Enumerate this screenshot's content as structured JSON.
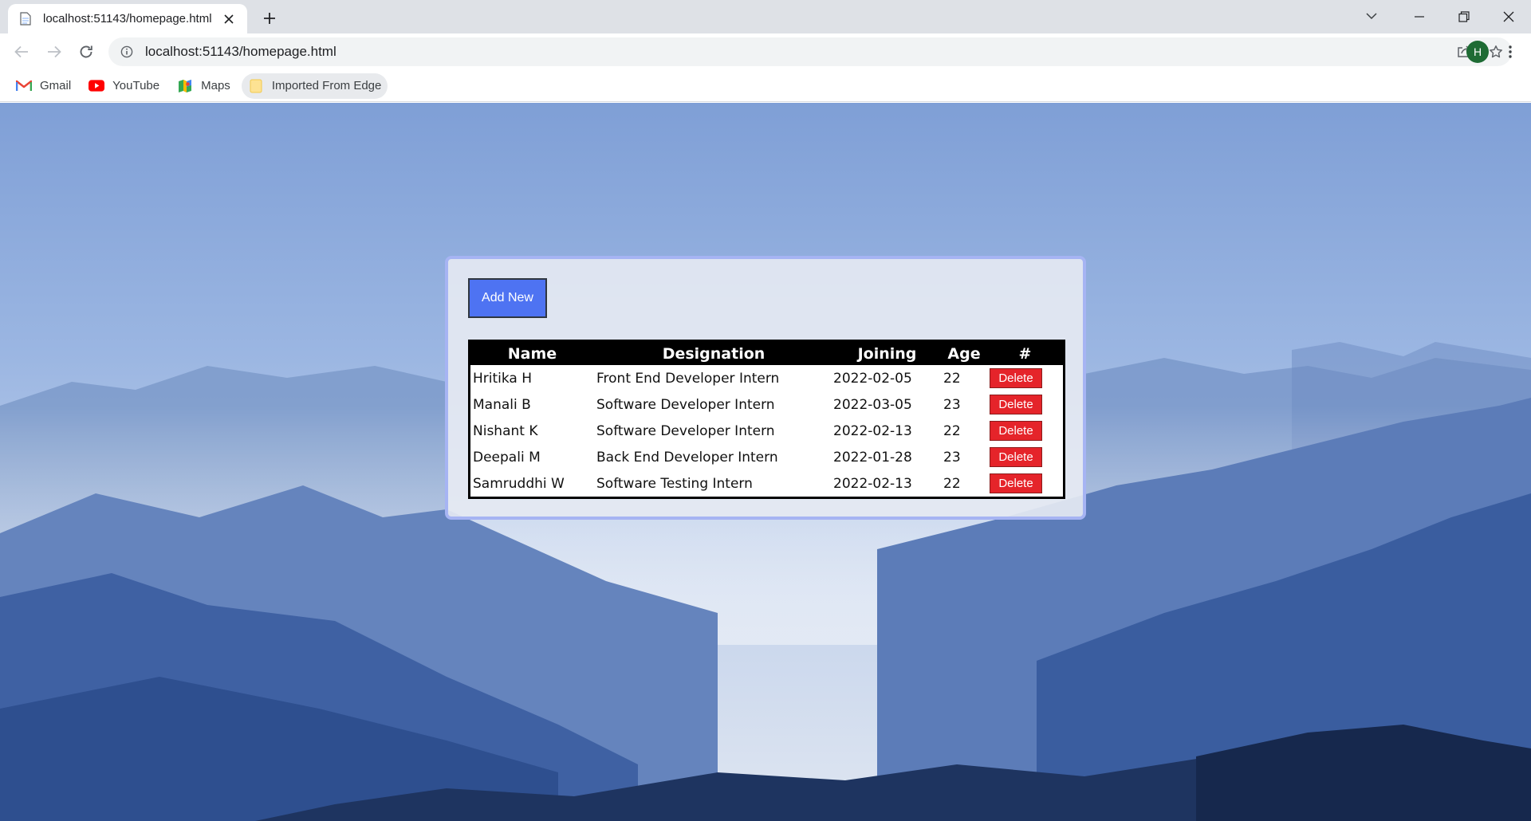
{
  "browser": {
    "tab_title": "localhost:51143/homepage.html",
    "url": "localhost:51143/homepage.html",
    "profile_initial": "H",
    "bookmarks": [
      {
        "label": "Gmail",
        "icon": "gmail-icon"
      },
      {
        "label": "YouTube",
        "icon": "youtube-icon"
      },
      {
        "label": "Maps",
        "icon": "maps-icon"
      },
      {
        "label": "Imported From Edge",
        "icon": "folder-icon"
      }
    ]
  },
  "page": {
    "add_button_label": "Add New",
    "table": {
      "headers": [
        "Name",
        "Designation",
        "Joining",
        "Age",
        "#"
      ],
      "rows": [
        {
          "name": "Hritika H",
          "designation": "Front End Developer Intern",
          "joining": "2022-02-05",
          "age": "22",
          "action": "Delete"
        },
        {
          "name": "Manali B",
          "designation": "Software Developer Intern",
          "joining": "2022-03-05",
          "age": "23",
          "action": "Delete"
        },
        {
          "name": "Nishant K",
          "designation": "Software Developer Intern",
          "joining": "2022-02-13",
          "age": "22",
          "action": "Delete"
        },
        {
          "name": "Deepali M",
          "designation": "Back End Developer Intern",
          "joining": "2022-01-28",
          "age": "23",
          "action": "Delete"
        },
        {
          "name": "Samruddhi W",
          "designation": "Software Testing Intern",
          "joining": "2022-02-13",
          "age": "22",
          "action": "Delete"
        }
      ]
    }
  },
  "colors": {
    "add_button": "#4e73f2",
    "delete_button": "#e5242a",
    "card_border": "#a6b4f3",
    "table_header": "#000000"
  }
}
